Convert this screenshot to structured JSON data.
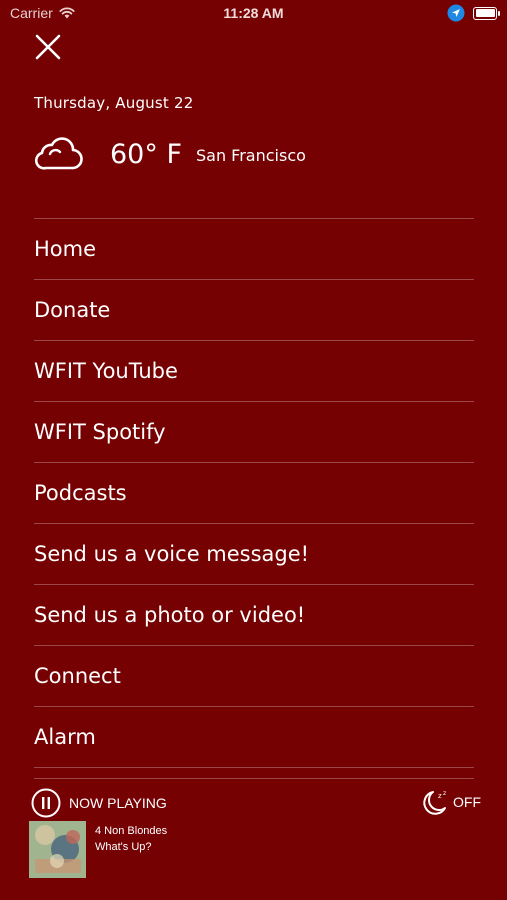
{
  "status_bar": {
    "carrier": "Carrier",
    "time": "11:28 AM"
  },
  "header": {
    "date": "Thursday, August 22",
    "weather": {
      "icon": "cloud-icon",
      "temperature": "60° F",
      "city": "San Francisco"
    }
  },
  "menu": {
    "items": [
      {
        "label": "Home"
      },
      {
        "label": "Donate"
      },
      {
        "label": "WFIT YouTube"
      },
      {
        "label": "WFIT Spotify"
      },
      {
        "label": "Podcasts"
      },
      {
        "label": "Send us a voice message!"
      },
      {
        "label": "Send us a photo or video!"
      },
      {
        "label": "Connect"
      },
      {
        "label": "Alarm"
      }
    ]
  },
  "player": {
    "now_playing_label": "NOW PLAYING",
    "sleep_timer_label": "OFF",
    "artist": "4 Non Blondes",
    "title": "What's Up?"
  },
  "colors": {
    "background": "#750103",
    "text": "#ffffff",
    "location_arrow": "#1e88e5"
  }
}
